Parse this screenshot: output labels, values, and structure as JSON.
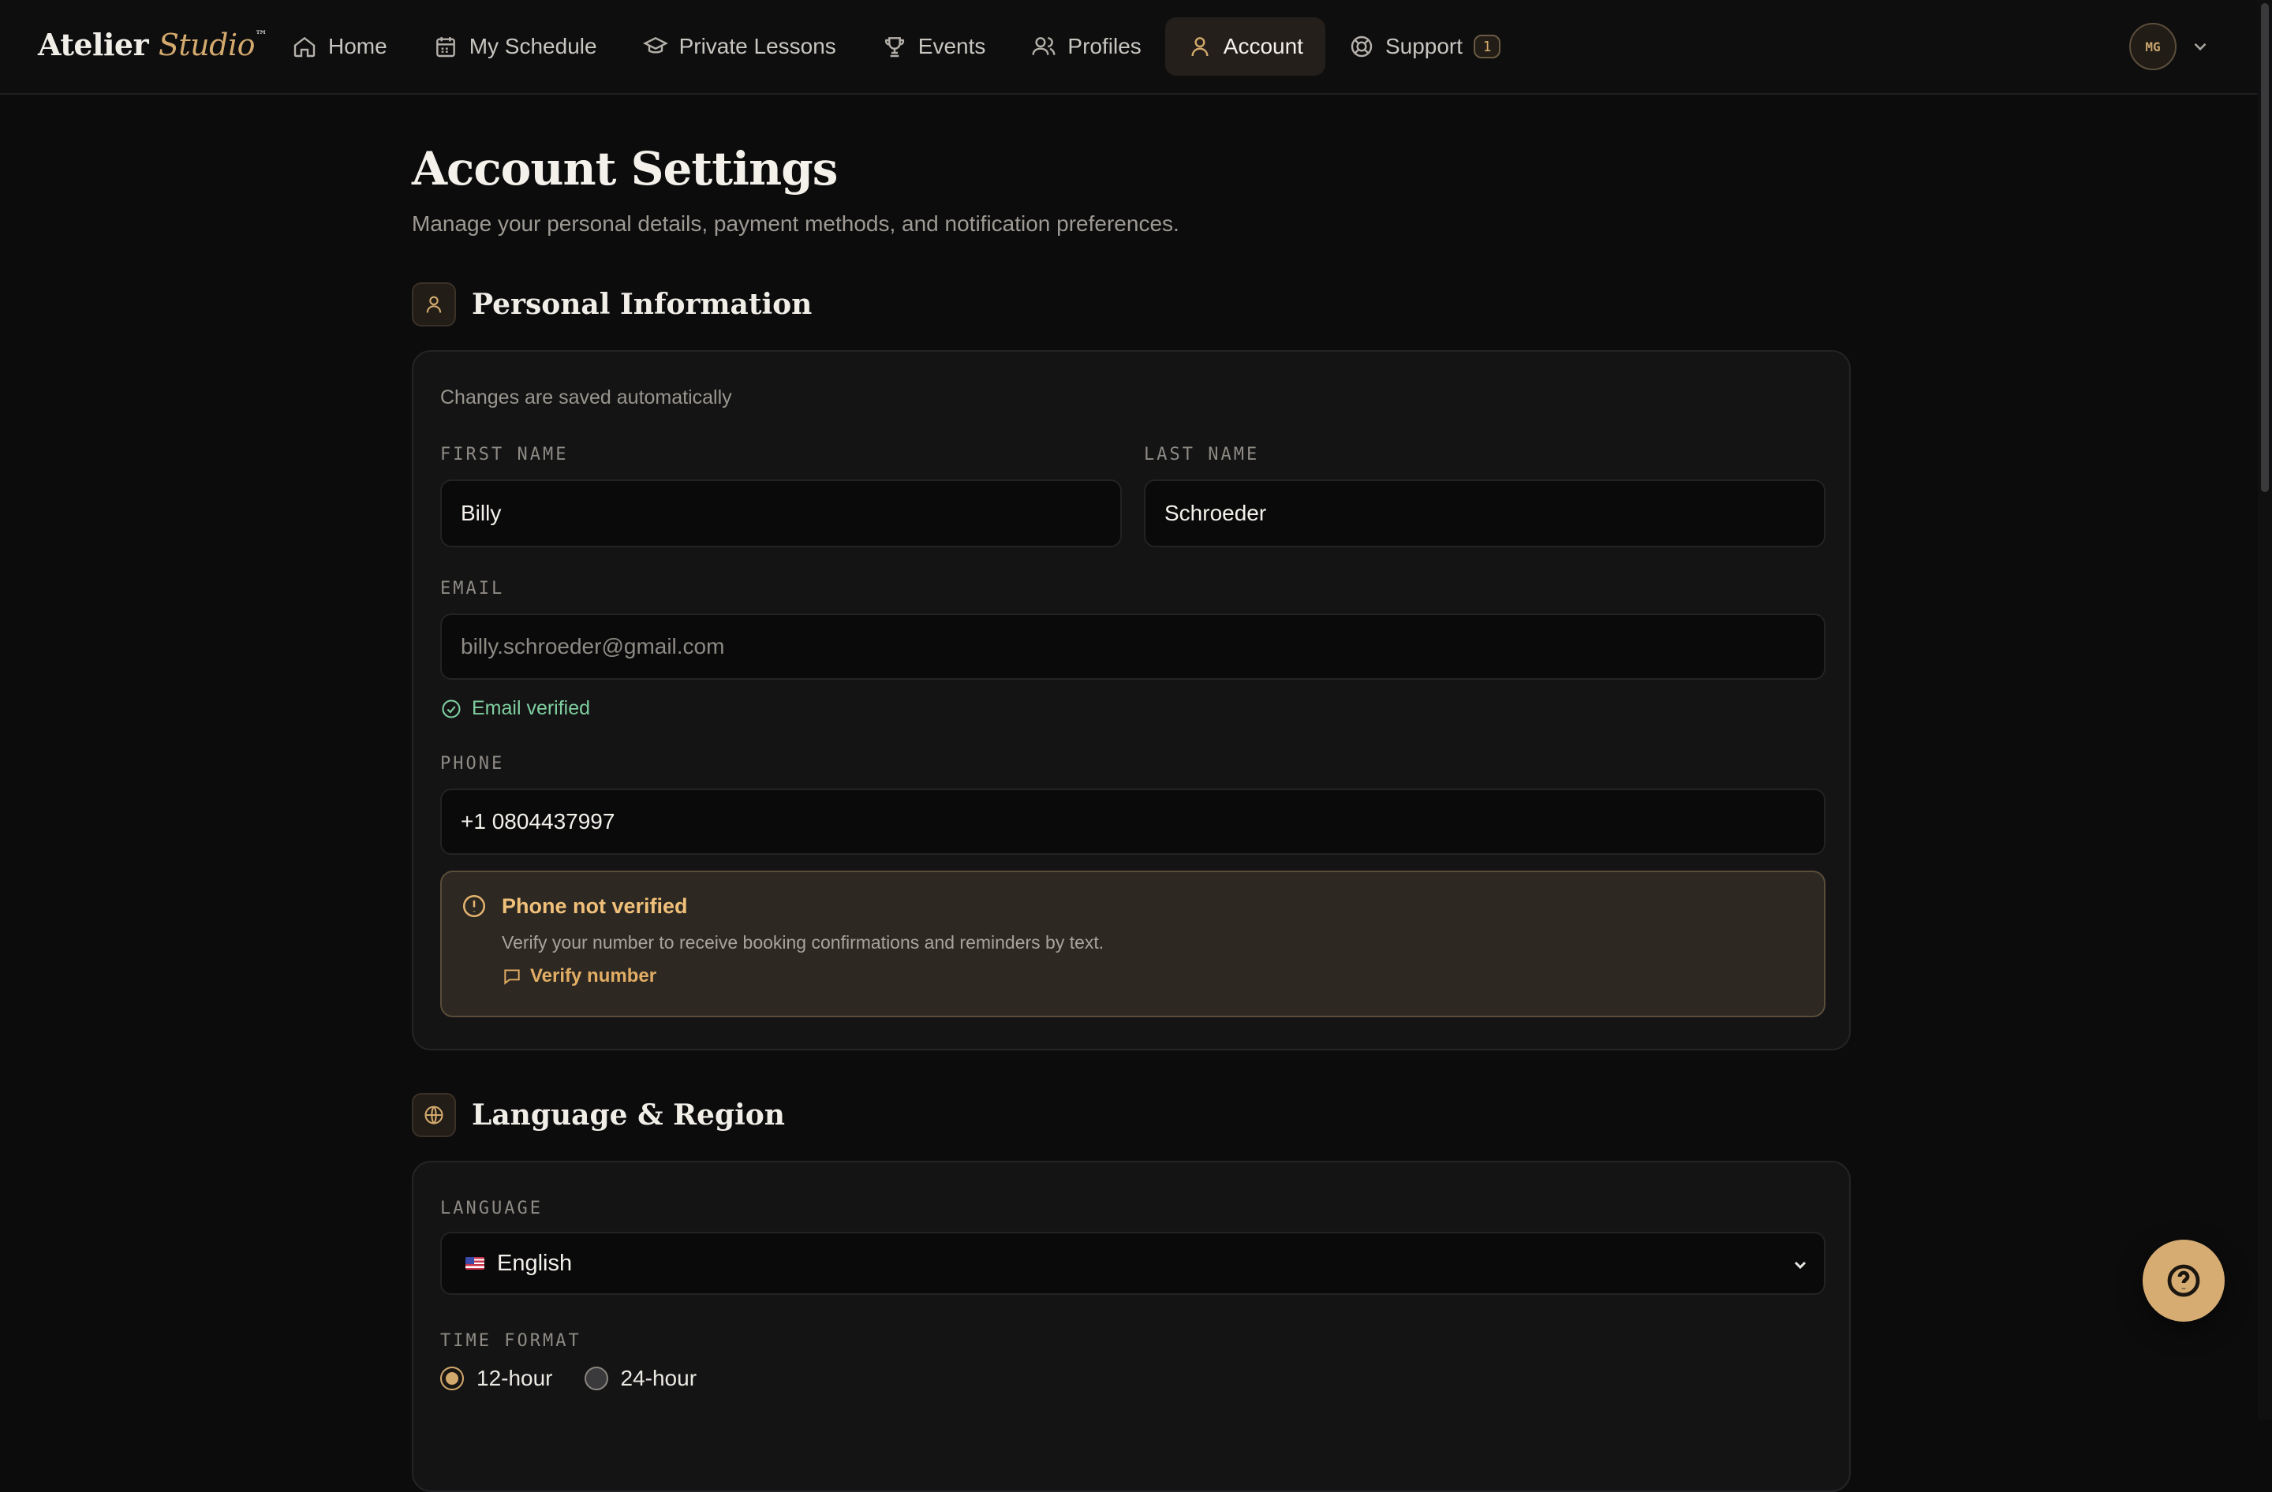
{
  "brand": {
    "name": "Atelier",
    "accent": "Studio",
    "mark": "™"
  },
  "nav": {
    "items": [
      {
        "label": "Home",
        "icon": "home-icon"
      },
      {
        "label": "My Schedule",
        "icon": "calendar-icon"
      },
      {
        "label": "Private Lessons",
        "icon": "graduation-cap-icon"
      },
      {
        "label": "Events",
        "icon": "trophy-icon"
      },
      {
        "label": "Profiles",
        "icon": "users-icon"
      },
      {
        "label": "Account",
        "icon": "user-icon",
        "active": true
      },
      {
        "label": "Support",
        "icon": "lifebuoy-icon",
        "badge": "1"
      }
    ]
  },
  "user": {
    "initials": "MG"
  },
  "page": {
    "title": "Account Settings",
    "subtitle": "Manage your personal details, payment methods, and notification preferences."
  },
  "personal": {
    "title": "Personal Information",
    "autosave_note": "Changes are saved automatically",
    "first_name_label": "FIRST NAME",
    "first_name": "Billy",
    "last_name_label": "LAST NAME",
    "last_name": "Schroeder",
    "email_label": "EMAIL",
    "email": "billy.schroeder@gmail.com",
    "email_status": "Email verified",
    "phone_label": "PHONE",
    "phone": "+1 0804437997",
    "phone_warning": {
      "title": "Phone not verified",
      "text": "Verify your number to receive booking confirmations and reminders by text.",
      "action": "Verify number"
    }
  },
  "language": {
    "title": "Language & Region",
    "language_label": "LANGUAGE",
    "language_value": "English",
    "language_flag": "us-flag-icon",
    "time_format_label": "TIME FORMAT",
    "time_formats": [
      {
        "label": "12-hour",
        "selected": true
      },
      {
        "label": "24-hour",
        "selected": false
      }
    ]
  },
  "colors": {
    "accent": "#d3a96d",
    "background": "#0c0c0d",
    "success": "#7fcfa0",
    "warning": "#f0c07a"
  }
}
